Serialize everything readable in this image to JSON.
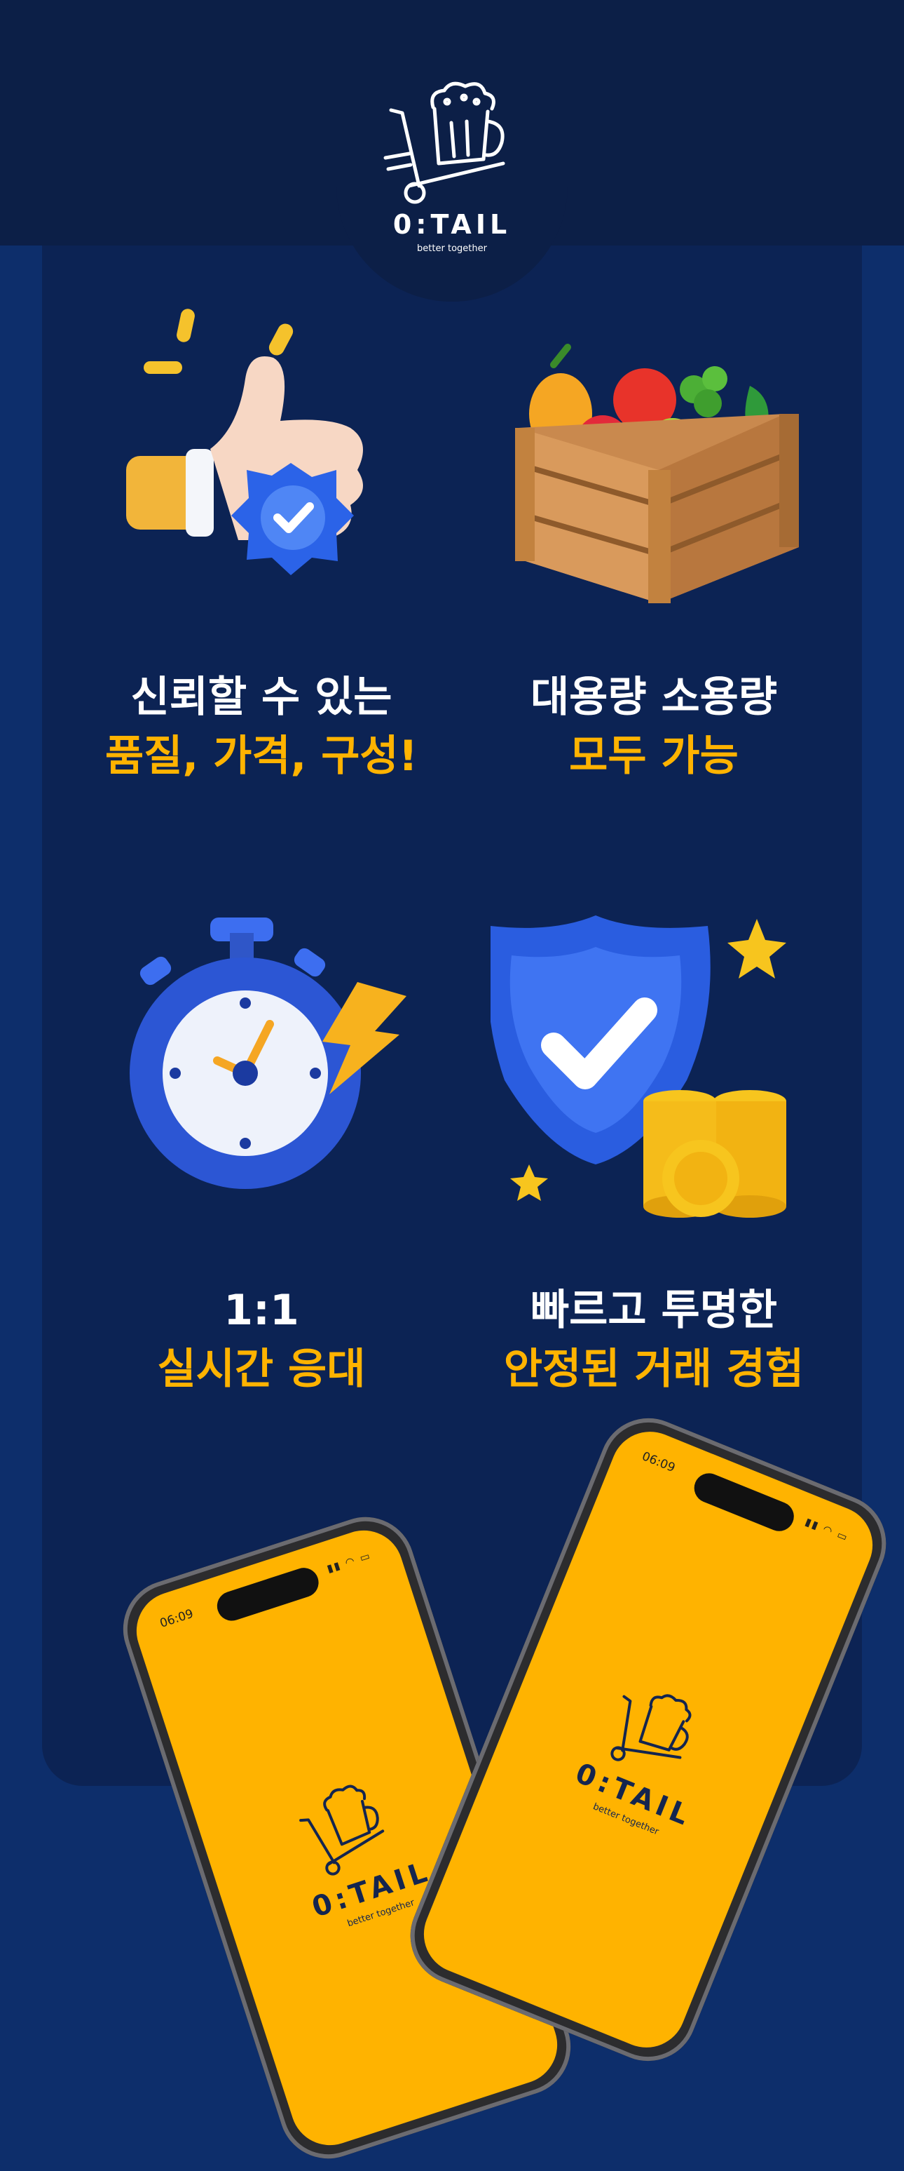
{
  "brand": {
    "name": "0:TAIL",
    "tagline": "better together"
  },
  "colors": {
    "background": "#0d2e6b",
    "panel": "#0c2354",
    "header": "#0c1f47",
    "accent": "#ffb300",
    "text": "#ffffff"
  },
  "features": [
    {
      "line1": "신뢰할 수 있는",
      "line2": "품질, 가격, 구성!",
      "icon": "thumbs-up-badge-icon"
    },
    {
      "line1": "대용량 소용량",
      "line2": "모두 가능",
      "icon": "vegetable-crate-icon"
    },
    {
      "line1": "1:1",
      "line2": "실시간 응대",
      "icon": "stopwatch-icon"
    },
    {
      "line1": "빠르고 투명한",
      "line2": "안정된 거래 경험",
      "icon": "shield-coins-icon"
    }
  ],
  "phones": [
    {
      "time": "06:09",
      "brand": "0:TAIL",
      "tagline": "better together"
    },
    {
      "time": "06:09",
      "brand": "0:TAIL",
      "tagline": "better together"
    }
  ]
}
